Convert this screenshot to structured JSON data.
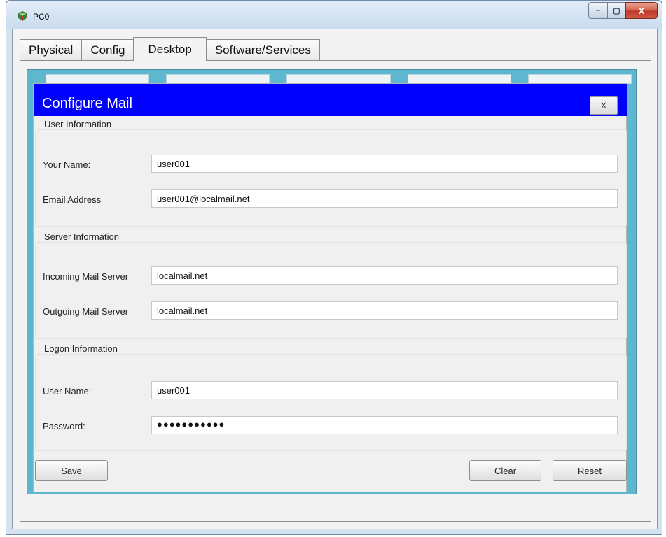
{
  "window": {
    "title": "PC0",
    "controls": {
      "minimize": "–",
      "maximize": "▢",
      "close": "X"
    }
  },
  "tabs": [
    {
      "label": "Physical",
      "active": false
    },
    {
      "label": "Config",
      "active": false
    },
    {
      "label": "Desktop",
      "active": true
    },
    {
      "label": "Software/Services",
      "active": false
    }
  ],
  "dialog": {
    "title": "Configure Mail",
    "close_label": "X",
    "header_color": "#0000ff",
    "desktop_color": "#5fb7cf",
    "user_information": {
      "title": "User Information",
      "your_name_label": "Your Name:",
      "your_name_value": "user001",
      "email_label": "Email Address",
      "email_value": "user001@localmail.net"
    },
    "server_information": {
      "title": "Server Information",
      "incoming_label": "Incoming Mail Server",
      "incoming_value": "localmail.net",
      "outgoing_label": "Outgoing Mail Server",
      "outgoing_value": "localmail.net"
    },
    "logon_information": {
      "title": "Logon Information",
      "username_label": "User Name:",
      "username_value": "user001",
      "password_label": "Password:",
      "password_masked": "●●●●●●●●●●●"
    },
    "buttons": {
      "save": "Save",
      "clear": "Clear",
      "reset": "Reset"
    }
  }
}
